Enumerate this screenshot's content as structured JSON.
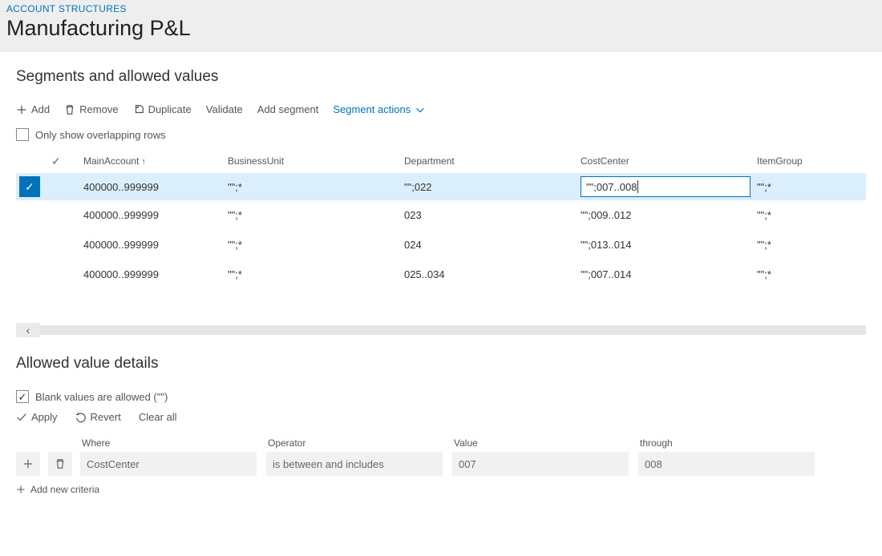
{
  "header": {
    "breadcrumb": "ACCOUNT STRUCTURES",
    "title": "Manufacturing P&L"
  },
  "segments": {
    "title": "Segments and allowed values",
    "toolbar": {
      "add": "Add",
      "remove": "Remove",
      "duplicate": "Duplicate",
      "validate": "Validate",
      "add_segment": "Add segment",
      "segment_actions": "Segment actions"
    },
    "only_overlapping_label": "Only show overlapping rows",
    "columns": {
      "main_account": "MainAccount",
      "business_unit": "BusinessUnit",
      "department": "Department",
      "cost_center": "CostCenter",
      "item_group": "ItemGroup"
    },
    "rows": [
      {
        "selected": true,
        "main_account": "400000..999999",
        "business_unit": "\"\";*",
        "department": "\"\";022",
        "cost_center": "\"\";007..008",
        "item_group": "\"\";*"
      },
      {
        "selected": false,
        "main_account": "400000..999999",
        "business_unit": "\"\";*",
        "department": "023",
        "cost_center": "\"\";009..012",
        "item_group": "\"\";*"
      },
      {
        "selected": false,
        "main_account": "400000..999999",
        "business_unit": "\"\";*",
        "department": "024",
        "cost_center": "\"\";013..014",
        "item_group": "\"\";*"
      },
      {
        "selected": false,
        "main_account": "400000..999999",
        "business_unit": "\"\";*",
        "department": "025..034",
        "cost_center": "\"\";007..014",
        "item_group": "\"\";*"
      }
    ]
  },
  "details": {
    "title": "Allowed value details",
    "blank_allowed_label": "Blank values are allowed (\"\")",
    "actions": {
      "apply": "Apply",
      "revert": "Revert",
      "clear_all": "Clear all"
    },
    "labels": {
      "where": "Where",
      "operator": "Operator",
      "value": "Value",
      "through": "through"
    },
    "criteria": {
      "where": "CostCenter",
      "operator": "is between and includes",
      "value": "007",
      "through": "008"
    },
    "add_new": "Add new criteria"
  }
}
